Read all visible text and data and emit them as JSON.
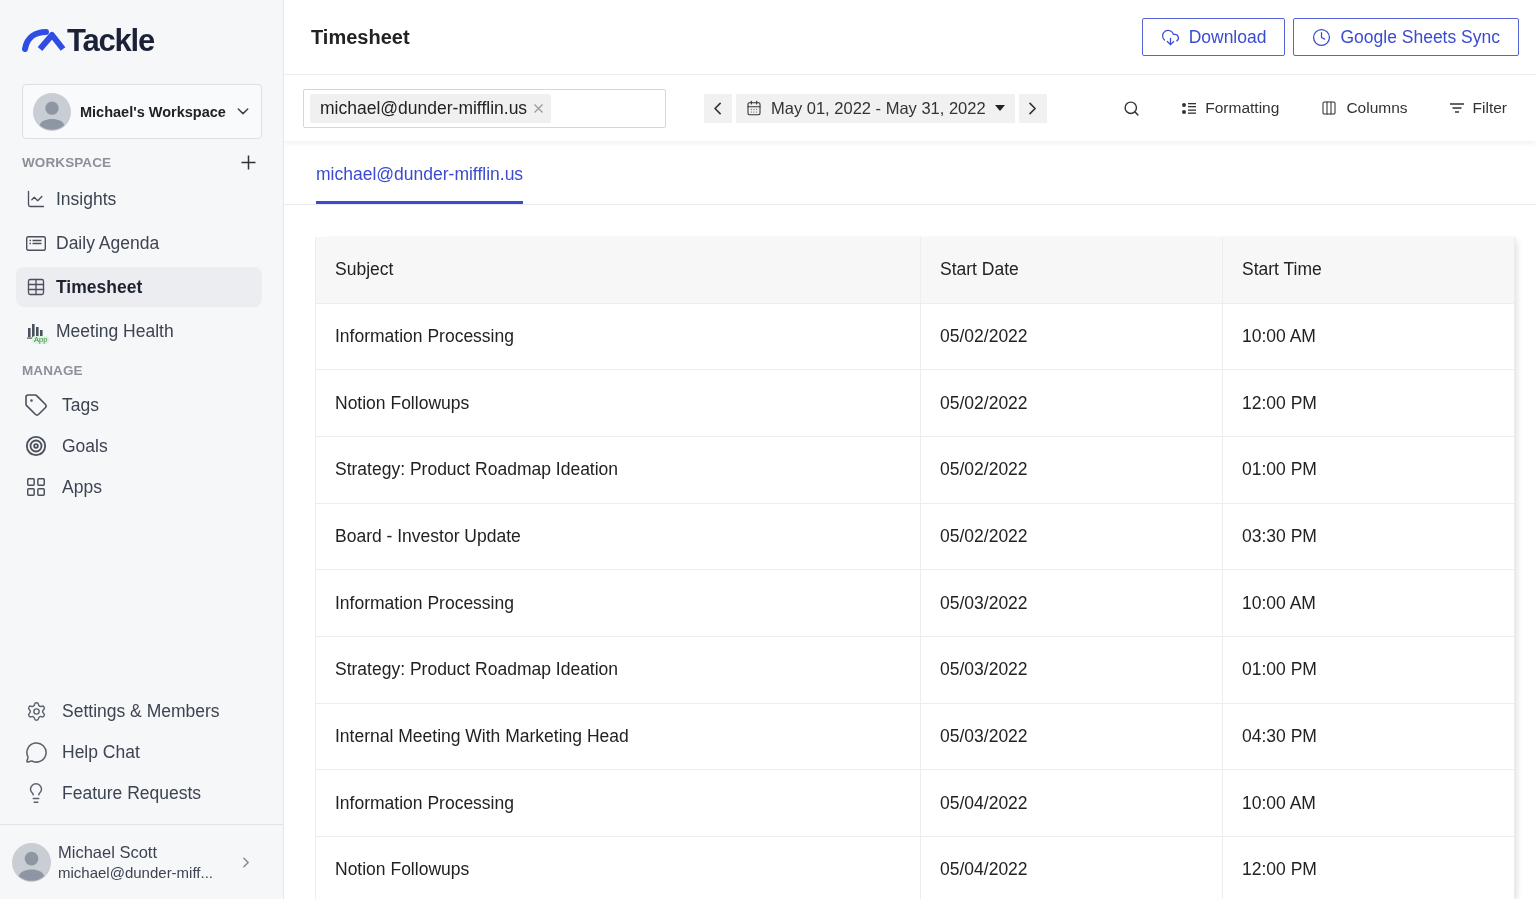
{
  "sidebar": {
    "logo": {
      "text": "Tackle"
    },
    "workspace_switcher": {
      "name": "Michael's Workspace"
    },
    "sections": [
      {
        "title": "WORKSPACE",
        "items": [
          {
            "label": "Insights",
            "selected": false
          },
          {
            "label": "Daily Agenda",
            "selected": false
          },
          {
            "label": "Timesheet",
            "selected": true
          },
          {
            "label": "Meeting Health",
            "badge": "App",
            "selected": false
          }
        ]
      },
      {
        "title": "MANAGE",
        "items": [
          {
            "label": "Tags",
            "selected": false
          },
          {
            "label": "Goals",
            "selected": false
          },
          {
            "label": "Apps",
            "selected": false
          }
        ]
      }
    ],
    "footer_links": [
      {
        "label": "Settings & Members"
      },
      {
        "label": "Help Chat"
      },
      {
        "label": "Feature Requests"
      }
    ],
    "user": {
      "name": "Michael Scott",
      "email": "michael@dunder-miff..."
    }
  },
  "header": {
    "title": "Timesheet",
    "buttons": [
      {
        "label": "Download"
      },
      {
        "label": "Google Sheets Sync"
      }
    ]
  },
  "toolbar": {
    "people_field": {
      "chips": [
        {
          "label": "michael@dunder-mifflin.us"
        }
      ]
    },
    "date_range": {
      "label": "May 01, 2022 - May 31, 2022"
    },
    "actions": [
      {
        "label": "Formatting"
      },
      {
        "label": "Columns"
      },
      {
        "label": "Filter"
      }
    ]
  },
  "tabs": [
    {
      "label": "michael@dunder-mifflin.us",
      "selected": true
    }
  ],
  "table": {
    "columns": [
      "Subject",
      "Start Date",
      "Start Time"
    ],
    "rows": [
      [
        "Information Processing",
        "05/02/2022",
        "10:00 AM"
      ],
      [
        "Notion Followups",
        "05/02/2022",
        "12:00 PM"
      ],
      [
        "Strategy: Product Roadmap Ideation",
        "05/02/2022",
        "01:00 PM"
      ],
      [
        "Board - Investor Update",
        "05/02/2022",
        "03:30 PM"
      ],
      [
        "Information Processing",
        "05/03/2022",
        "10:00 AM"
      ],
      [
        "Strategy: Product Roadmap Ideation",
        "05/03/2022",
        "01:00 PM"
      ],
      [
        "Internal Meeting With Marketing Head",
        "05/03/2022",
        "04:30 PM"
      ],
      [
        "Information Processing",
        "05/04/2022",
        "10:00 AM"
      ],
      [
        "Notion Followups",
        "05/04/2022",
        "12:00 PM"
      ]
    ]
  }
}
